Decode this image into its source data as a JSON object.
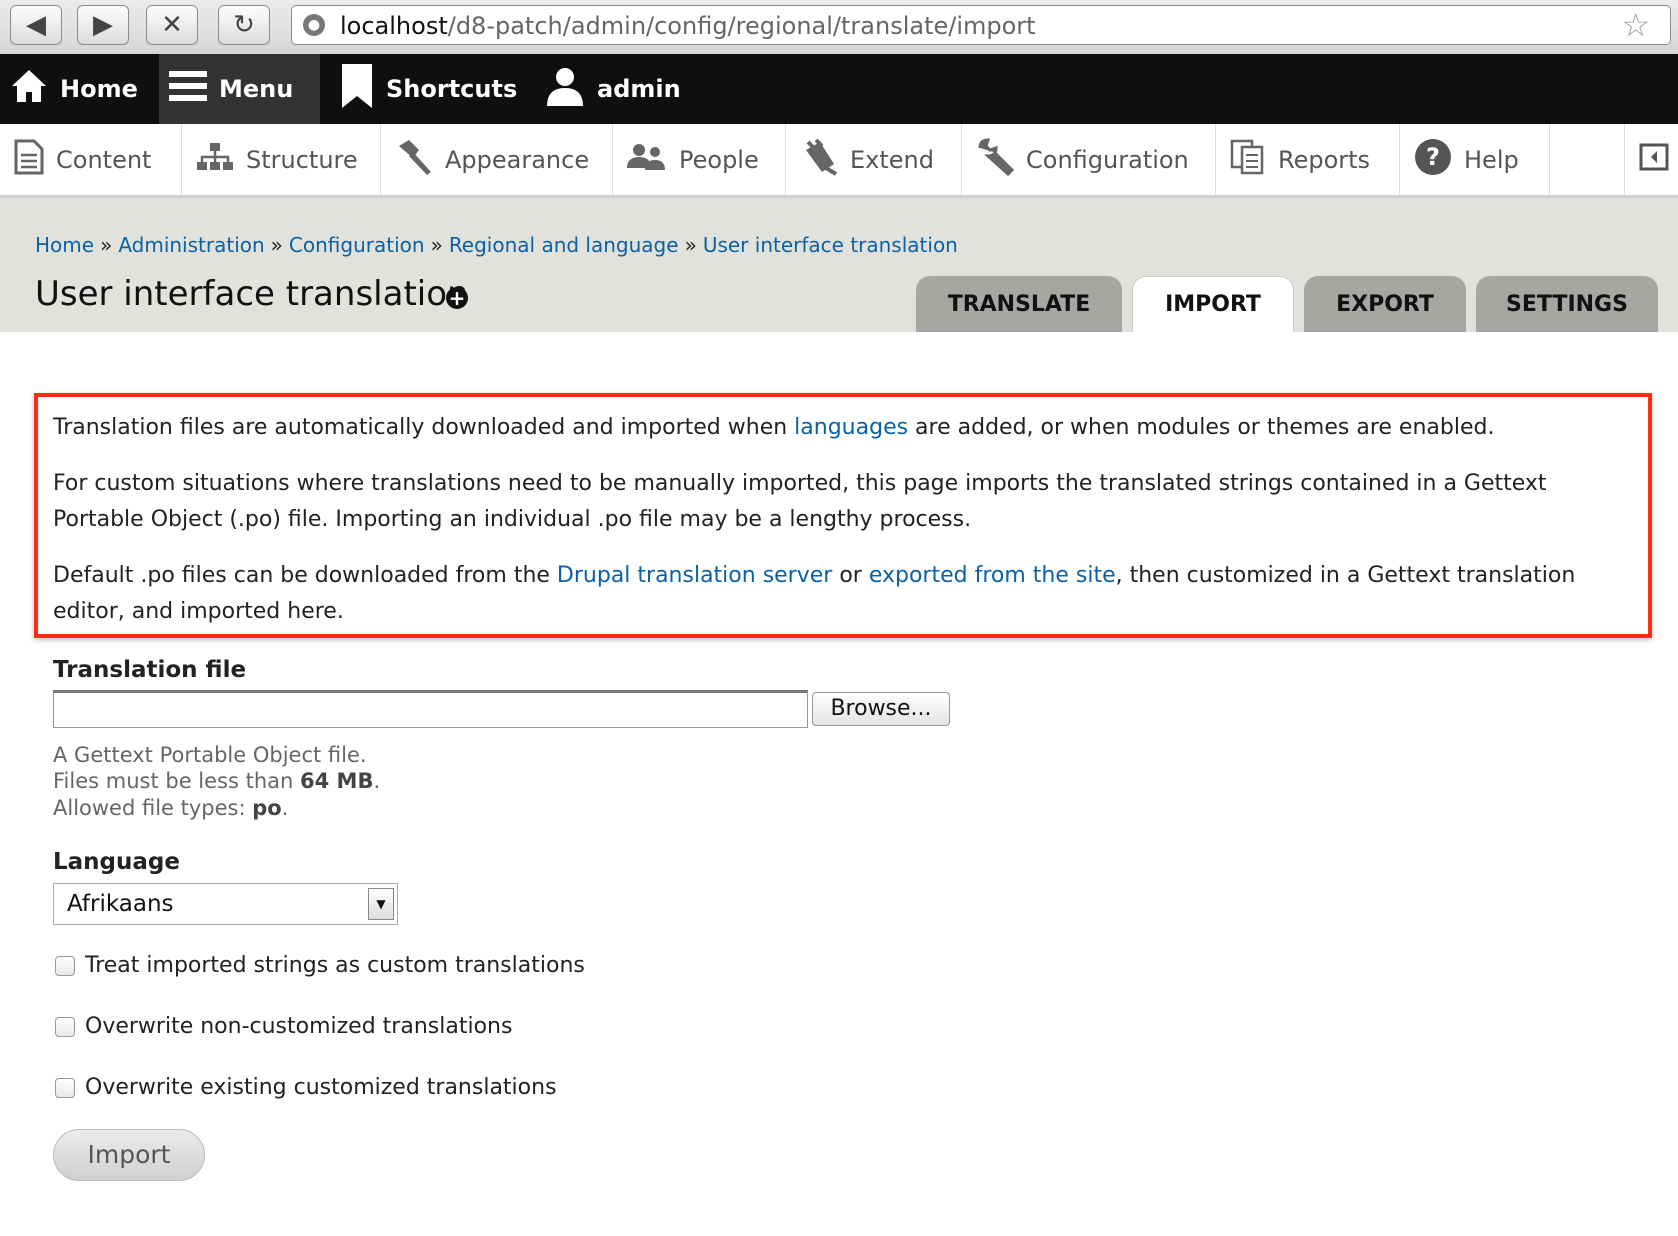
{
  "browser": {
    "url_host": "localhost",
    "url_path": "/d8-patch/admin/config/regional/translate/import"
  },
  "toolbar": {
    "home": "Home",
    "menu": "Menu",
    "shortcuts": "Shortcuts",
    "user": "admin"
  },
  "tray": {
    "items": [
      "Content",
      "Structure",
      "Appearance",
      "People",
      "Extend",
      "Configuration",
      "Reports",
      "Help"
    ]
  },
  "breadcrumb": [
    "Home",
    "Administration",
    "Configuration",
    "Regional and language",
    "User interface translation"
  ],
  "breadcrumb_separator": "»",
  "page_title": "User interface translation",
  "tabs": [
    "TRANSLATE",
    "IMPORT",
    "EXPORT",
    "SETTINGS"
  ],
  "active_tab": "IMPORT",
  "help": {
    "p1_before": "Translation files are automatically downloaded and imported when ",
    "p1_link": "languages",
    "p1_after": " are added, or when modules or themes are enabled.",
    "p2": "For custom situations where translations need to be manually imported, this page imports the translated strings contained in a Gettext Portable Object (.po) file. Importing an individual .po file may be a lengthy process.",
    "p3_before": "Default .po files can be downloaded from the ",
    "p3_link1": "Drupal translation server",
    "p3_mid": " or ",
    "p3_link2": "exported from the site",
    "p3_after": ", then customized in a Gettext translation editor, and imported here."
  },
  "form": {
    "file_label": "Translation file",
    "browse_label": "Browse...",
    "file_desc1": "A Gettext Portable Object file.",
    "file_desc2_before": "Files must be less than ",
    "file_desc2_bold": "64 MB",
    "file_desc2_after": ".",
    "file_desc3_before": "Allowed file types: ",
    "file_desc3_bold": "po",
    "file_desc3_after": ".",
    "language_label": "Language",
    "language_value": "Afrikaans",
    "checkbox1": "Treat imported strings as custom translations",
    "checkbox2": "Overwrite non-customized translations",
    "checkbox3": "Overwrite existing customized translations",
    "import_label": "Import"
  },
  "colors": {
    "toolbar_bg": "#0f0f0f",
    "link": "#0a61a8",
    "highlight_border": "#ff2b13",
    "header_bg": "#e1e2dc"
  }
}
